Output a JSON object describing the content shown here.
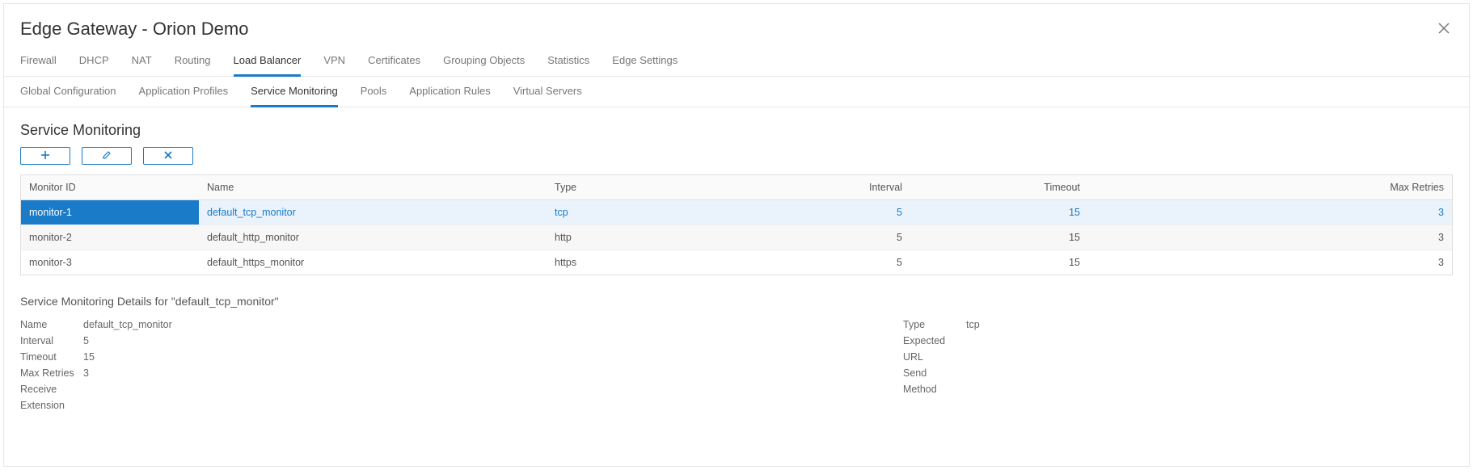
{
  "header": {
    "title": "Edge Gateway - Orion Demo"
  },
  "tabs": {
    "items": [
      "Firewall",
      "DHCP",
      "NAT",
      "Routing",
      "Load Balancer",
      "VPN",
      "Certificates",
      "Grouping Objects",
      "Statistics",
      "Edge Settings"
    ],
    "active": "Load Balancer"
  },
  "subtabs": {
    "items": [
      "Global Configuration",
      "Application Profiles",
      "Service Monitoring",
      "Pools",
      "Application Rules",
      "Virtual Servers"
    ],
    "active": "Service Monitoring"
  },
  "content": {
    "title": "Service Monitoring",
    "columns": {
      "id": "Monitor ID",
      "name": "Name",
      "type": "Type",
      "interval": "Interval",
      "timeout": "Timeout",
      "max": "Max Retries"
    },
    "rows": [
      {
        "id": "monitor-1",
        "name": "default_tcp_monitor",
        "type": "tcp",
        "interval": "5",
        "timeout": "15",
        "max": "3",
        "selected": true
      },
      {
        "id": "monitor-2",
        "name": "default_http_monitor",
        "type": "http",
        "interval": "5",
        "timeout": "15",
        "max": "3"
      },
      {
        "id": "monitor-3",
        "name": "default_https_monitor",
        "type": "https",
        "interval": "5",
        "timeout": "15",
        "max": "3"
      }
    ]
  },
  "details": {
    "title": "Service Monitoring Details for \"default_tcp_monitor\"",
    "left": {
      "name_k": "Name",
      "name_v": "default_tcp_monitor",
      "interval_k": "Interval",
      "interval_v": "5",
      "timeout_k": "Timeout",
      "timeout_v": "15",
      "max_k": "Max Retries",
      "max_v": "3",
      "receive_k": "Receive",
      "receive_v": "",
      "ext_k": "Extension",
      "ext_v": ""
    },
    "right": {
      "type_k": "Type",
      "type_v": "tcp",
      "expected_k": "Expected",
      "expected_v": "",
      "url_k": "URL",
      "url_v": "",
      "send_k": "Send",
      "send_v": "",
      "method_k": "Method",
      "method_v": ""
    }
  }
}
